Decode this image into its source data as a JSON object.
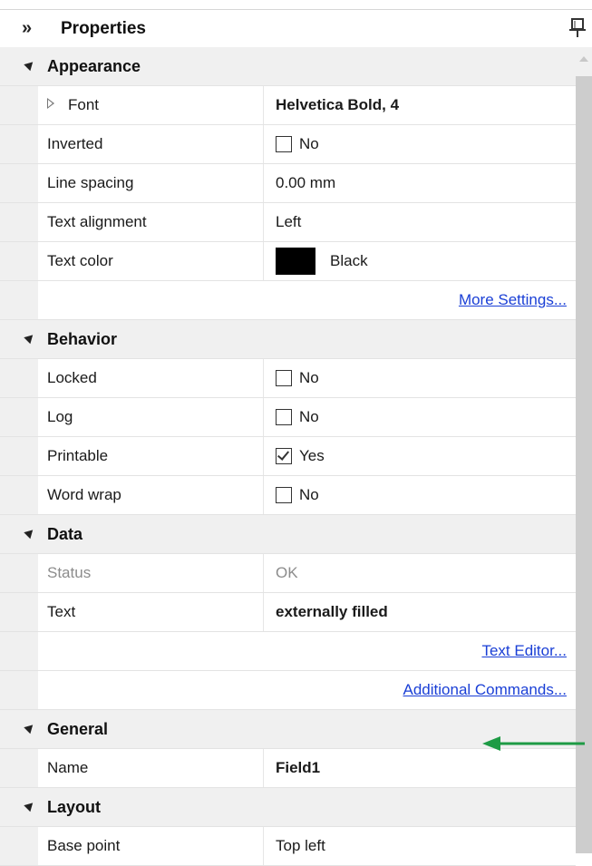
{
  "header": {
    "collapse_glyph": "»",
    "title": "Properties",
    "pin_icon": "pin-icon"
  },
  "categories": {
    "appearance": "Appearance",
    "behavior": "Behavior",
    "data": "Data",
    "general": "General",
    "layout": "Layout"
  },
  "appearance": {
    "font": {
      "name": "Font",
      "value": "Helvetica Bold, 4"
    },
    "inverted": {
      "name": "Inverted",
      "value": "No",
      "checked": false
    },
    "line_spacing": {
      "name": "Line spacing",
      "value": "0.00 mm"
    },
    "text_alignment": {
      "name": "Text alignment",
      "value": "Left"
    },
    "text_color": {
      "name": "Text color",
      "value": "Black",
      "swatch": "#000000"
    },
    "more_settings": "More Settings..."
  },
  "behavior": {
    "locked": {
      "name": "Locked",
      "value": "No",
      "checked": false
    },
    "log": {
      "name": "Log",
      "value": "No",
      "checked": false
    },
    "printable": {
      "name": "Printable",
      "value": "Yes",
      "checked": true
    },
    "word_wrap": {
      "name": "Word wrap",
      "value": "No",
      "checked": false
    }
  },
  "data_section": {
    "status": {
      "name": "Status",
      "value": "OK"
    },
    "text": {
      "name": "Text",
      "value": "externally filled"
    },
    "text_editor": "Text Editor...",
    "additional_commands": "Additional Commands..."
  },
  "general": {
    "name": {
      "name": "Name",
      "value": "Field1"
    }
  },
  "layout": {
    "base_point": {
      "name": "Base point",
      "value": "Top left"
    }
  },
  "colors": {
    "link": "#1a3fd6",
    "annotation_arrow": "#1e9b45",
    "gutter": "#f0f0f0"
  }
}
